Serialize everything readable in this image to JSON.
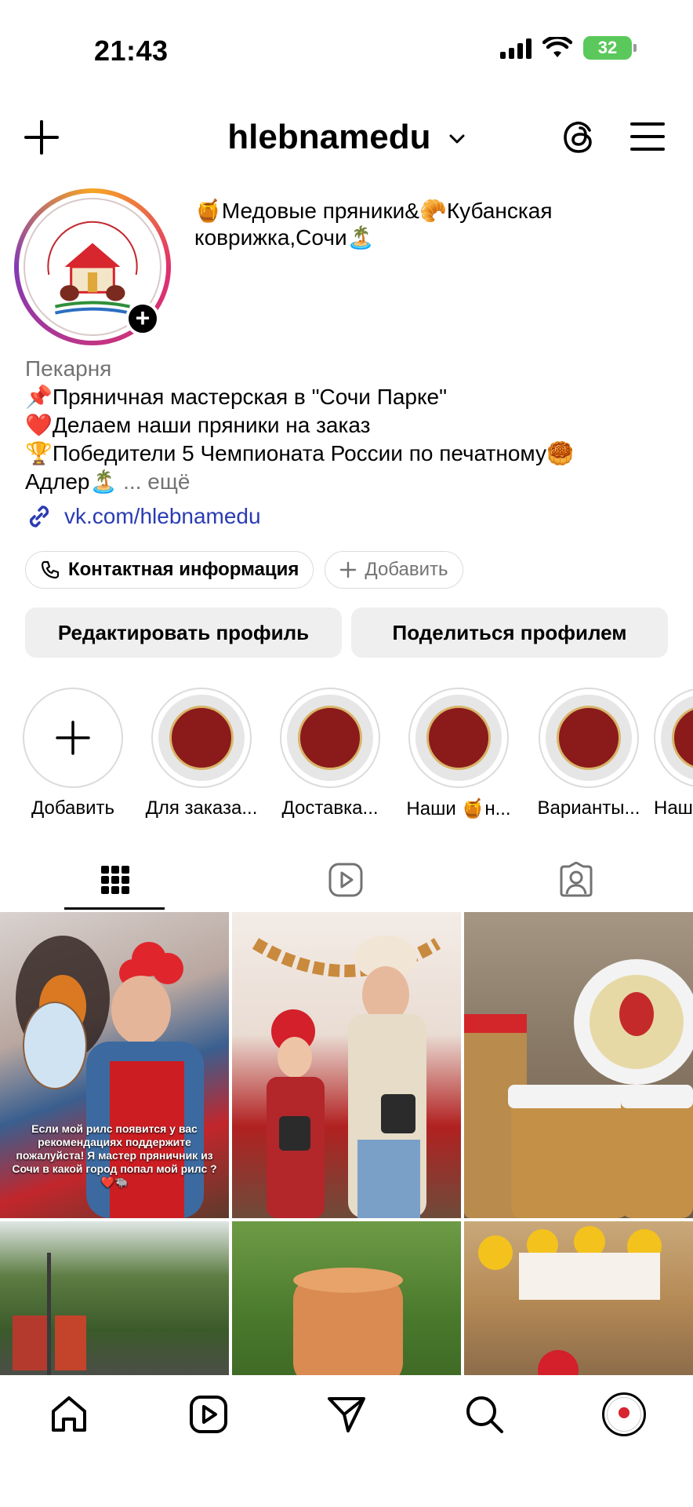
{
  "status_bar": {
    "time": "21:43",
    "battery": "32"
  },
  "header": {
    "username": "hlebnamedu"
  },
  "profile": {
    "name": "🍯Медовые пряники&🥐Кубанская коврижка,Сочи🏝️",
    "category": "Пекарня",
    "bio_lines": [
      "📌Пряничная мастерская в \"Сочи Парке\"",
      "❤️Делаем наши пряники на заказ",
      "🏆Победители 5 Чемпионата России по печатному🥮",
      "Адлер🏝️"
    ],
    "more_label": "... ещё",
    "link": "vk.com/hlebnamedu"
  },
  "chips": {
    "contact": "Контактная информация",
    "add": "Добавить"
  },
  "actions": {
    "edit": "Редактировать профиль",
    "share": "Поделиться профилем"
  },
  "highlights": [
    {
      "label": "Добавить"
    },
    {
      "label": "Для заказа..."
    },
    {
      "label": "Доставка..."
    },
    {
      "label": "Наши 🍯н..."
    },
    {
      "label": "Варианты..."
    },
    {
      "label": "Наш"
    }
  ],
  "grid": {
    "reel_caption": "Если мой рилс появится у вас рекомендациях поддержите пожалуйста! Я мастер пряничник из Сочи в какой город попал мой рилс ? ❤️🐃"
  }
}
